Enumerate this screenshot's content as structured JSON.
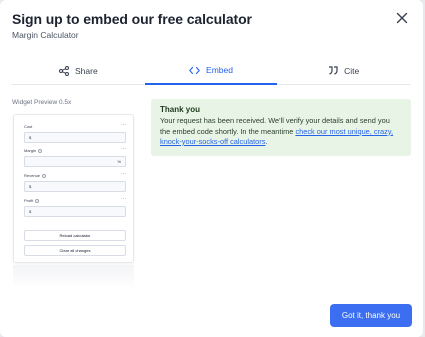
{
  "dialog": {
    "title": "Sign up to embed our free calculator",
    "subtitle": "Margin Calculator"
  },
  "tabs": [
    {
      "label": "Share",
      "icon": "share-icon",
      "active": false
    },
    {
      "label": "Embed",
      "icon": "code-icon",
      "active": true
    },
    {
      "label": "Cite",
      "icon": "quote-icon",
      "active": false
    }
  ],
  "preview": {
    "label": "Widget Preview 0.5x",
    "fields": [
      {
        "label": "Cost",
        "value": "$",
        "has_info": false
      },
      {
        "label": "Margin",
        "value": "%",
        "has_info": true
      },
      {
        "label": "Revenue",
        "value": "$",
        "has_info": true
      },
      {
        "label": "Profit",
        "value": "$",
        "has_info": true
      }
    ],
    "more": "···",
    "reload_label": "Reload calculator",
    "clear_label": "Clear all changes"
  },
  "notice": {
    "title": "Thank you",
    "text": "Your request has been received. We'll verify your details and send you the embed code shortly. In the meantime ",
    "link_text": "check our most unique, crazy, knock-your-socks-off calculators",
    "suffix": "."
  },
  "footer": {
    "button_label": "Got it, thank you"
  },
  "colors": {
    "accent": "#3b6ef0",
    "link": "#2563eb",
    "notice_bg": "#e8f5e6"
  }
}
